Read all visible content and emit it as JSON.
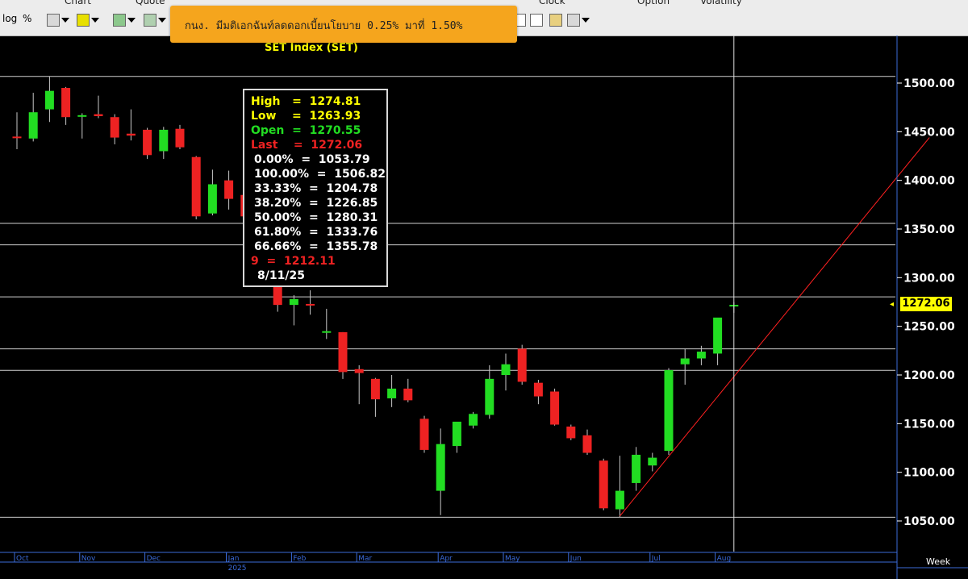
{
  "toolbar": {
    "log_label": "log",
    "percent_label": "%",
    "chart_menu": "Chart",
    "quote_menu": "Quote",
    "clock_menu": "Clock",
    "option_menu": "Option",
    "volatility_menu": "Volatility"
  },
  "notification": {
    "text": "กนง. มีมติเอกฉันท์ลดดอกเบี้ยนโยบาย 0.25% มาที่ 1.50%"
  },
  "chart_data": {
    "type": "candlestick",
    "title": "SET Index (SET)",
    "period": "Week",
    "y_range": [
      1010,
      1540
    ],
    "y_ticks": [
      1050,
      1100,
      1150,
      1200,
      1250,
      1300,
      1350,
      1400,
      1450,
      1500
    ],
    "y_tick_labels": [
      "1050.00",
      "1100.00",
      "1150.00",
      "1200.00",
      "1250.00",
      "1300.00",
      "1350.00",
      "1400.00",
      "1450.00",
      "1500.00"
    ],
    "x_labels": [
      {
        "label": "Oct",
        "index": 0
      },
      {
        "label": "Nov",
        "index": 4
      },
      {
        "label": "Dec",
        "index": 8
      },
      {
        "label": "Jan",
        "index": 13
      },
      {
        "label": "2025",
        "index": 13
      },
      {
        "label": "Feb",
        "index": 17
      },
      {
        "label": "Mar",
        "index": 21
      },
      {
        "label": "Apr",
        "index": 26
      },
      {
        "label": "May",
        "index": 30
      },
      {
        "label": "Jun",
        "index": 34
      },
      {
        "label": "Jul",
        "index": 39
      },
      {
        "label": "Aug",
        "index": 43
      }
    ],
    "candles": [
      {
        "open": 1445,
        "high": 1470,
        "low": 1432,
        "close": 1444
      },
      {
        "open": 1443,
        "high": 1490,
        "low": 1440,
        "close": 1470
      },
      {
        "open": 1473,
        "high": 1507,
        "low": 1460,
        "close": 1492
      },
      {
        "open": 1495,
        "high": 1496,
        "low": 1457,
        "close": 1465
      },
      {
        "open": 1467,
        "high": 1469,
        "low": 1443,
        "close": 1467
      },
      {
        "open": 1468,
        "high": 1487,
        "low": 1464,
        "close": 1466
      },
      {
        "open": 1465,
        "high": 1468,
        "low": 1437,
        "close": 1444
      },
      {
        "open": 1448,
        "high": 1473,
        "low": 1441,
        "close": 1446
      },
      {
        "open": 1452,
        "high": 1454,
        "low": 1422,
        "close": 1426
      },
      {
        "open": 1430,
        "high": 1455,
        "low": 1422,
        "close": 1452
      },
      {
        "open": 1453,
        "high": 1457,
        "low": 1432,
        "close": 1434
      },
      {
        "open": 1424,
        "high": 1425,
        "low": 1360,
        "close": 1363
      },
      {
        "open": 1366,
        "high": 1411,
        "low": 1364,
        "close": 1396
      },
      {
        "open": 1400,
        "high": 1410,
        "low": 1370,
        "close": 1381
      },
      {
        "open": 1385,
        "high": 1400,
        "low": 1345,
        "close": 1363
      },
      {
        "open": 1360,
        "high": 1362,
        "low": 1326,
        "close": 1330
      },
      {
        "open": 1320,
        "high": 1324,
        "low": 1265,
        "close": 1272
      },
      {
        "open": 1272,
        "high": 1282,
        "low": 1251,
        "close": 1278
      },
      {
        "open": 1273,
        "high": 1287,
        "low": 1262,
        "close": 1272
      },
      {
        "open": 1245,
        "high": 1268,
        "low": 1237,
        "close": 1245
      },
      {
        "open": 1244,
        "high": 1244,
        "low": 1196,
        "close": 1203
      },
      {
        "open": 1206,
        "high": 1210,
        "low": 1170,
        "close": 1202
      },
      {
        "open": 1196,
        "high": 1197,
        "low": 1157,
        "close": 1175
      },
      {
        "open": 1176,
        "high": 1200,
        "low": 1167,
        "close": 1186
      },
      {
        "open": 1186,
        "high": 1196,
        "low": 1172,
        "close": 1174
      },
      {
        "open": 1155,
        "high": 1158,
        "low": 1120,
        "close": 1123
      },
      {
        "open": 1081,
        "high": 1145,
        "low": 1056,
        "close": 1129
      },
      {
        "open": 1127,
        "high": 1150,
        "low": 1120,
        "close": 1152
      },
      {
        "open": 1148,
        "high": 1162,
        "low": 1145,
        "close": 1160
      },
      {
        "open": 1159,
        "high": 1210,
        "low": 1155,
        "close": 1196
      },
      {
        "open": 1200,
        "high": 1222,
        "low": 1184,
        "close": 1211
      },
      {
        "open": 1227,
        "high": 1231,
        "low": 1190,
        "close": 1193
      },
      {
        "open": 1192,
        "high": 1195,
        "low": 1170,
        "close": 1178
      },
      {
        "open": 1183,
        "high": 1186,
        "low": 1148,
        "close": 1149
      },
      {
        "open": 1147,
        "high": 1149,
        "low": 1133,
        "close": 1135
      },
      {
        "open": 1138,
        "high": 1144,
        "low": 1118,
        "close": 1120
      },
      {
        "open": 1112,
        "high": 1114,
        "low": 1061,
        "close": 1063
      },
      {
        "open": 1062,
        "high": 1117,
        "low": 1054,
        "close": 1081
      },
      {
        "open": 1089,
        "high": 1126,
        "low": 1081,
        "close": 1118
      },
      {
        "open": 1107,
        "high": 1120,
        "low": 1101,
        "close": 1115
      },
      {
        "open": 1122,
        "high": 1207,
        "low": 1118,
        "close": 1205
      },
      {
        "open": 1211,
        "high": 1227,
        "low": 1190,
        "close": 1217
      },
      {
        "open": 1217,
        "high": 1230,
        "low": 1210,
        "close": 1224
      },
      {
        "open": 1222,
        "high": 1256,
        "low": 1210,
        "close": 1259
      },
      {
        "open": 1270.55,
        "high": 1274.81,
        "low": 1263.93,
        "close": 1272.06
      }
    ],
    "horizontal_levels": [
      1053.79,
      1204.78,
      1226.85,
      1280.31,
      1333.76,
      1355.78,
      1506.82
    ],
    "trendline": {
      "from": {
        "index": 37,
        "value": 1055
      },
      "to": {
        "index": 56,
        "value": 1444
      }
    },
    "crosshair_index": 44,
    "last_price": "1272.06",
    "colors": {
      "background": "#000000",
      "up": "#22dd22",
      "down": "#ee2222",
      "wick": "#c8c8c8",
      "levels": "#d0d0d0",
      "trendline": "#ff2020",
      "axis_text": "#ffffff",
      "axis_labels": "#3b6bd9",
      "title": "#ffff00"
    }
  },
  "info_box": {
    "high": "High   =  1274.81",
    "low": "Low    =  1263.93",
    "open": "Open  =  1270.55",
    "last": "Last    =  1272.06",
    "fib_000": "0.00%  =  1053.79",
    "fib_100": "100.00%  =  1506.82",
    "fib_3333": "33.33%  =  1204.78",
    "fib_382": "38.20%  =  1226.85",
    "fib_50": "50.00%  =  1280.31",
    "fib_618": "61.80%  =  1333.76",
    "fib_6666": "66.66%  =  1355.78",
    "nine": "9  =  1212.11",
    "date": "8/11/25"
  }
}
